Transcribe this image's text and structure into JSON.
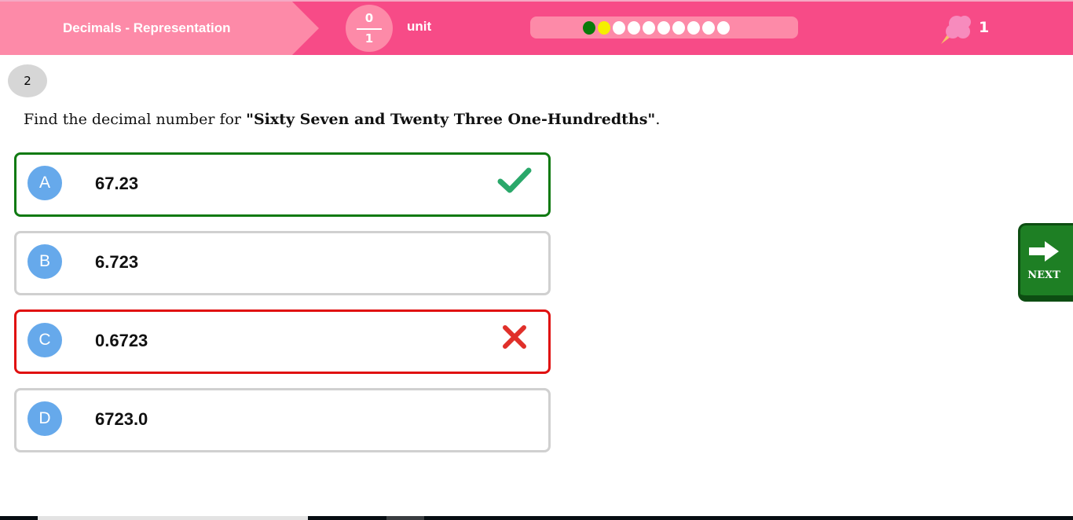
{
  "header": {
    "lesson_title": "Decimals - Representation",
    "fraction": {
      "numerator": "0",
      "denominator": "1"
    },
    "unit_label": "unit",
    "progress_dots": [
      "#0a7a0a",
      "#f5ef00",
      "#ffffff",
      "#ffffff",
      "#ffffff",
      "#ffffff",
      "#ffffff",
      "#ffffff",
      "#ffffff",
      "#ffffff"
    ],
    "reward_icon": "cotton-candy-icon",
    "reward_count": "1"
  },
  "question": {
    "number": "2",
    "prefix": "Find the decimal number for ",
    "quoted": "\"Sixty Seven and Twenty Three One-Hundredths\"",
    "suffix": "."
  },
  "options": [
    {
      "letter": "A",
      "value": "67.23",
      "state": "correct"
    },
    {
      "letter": "B",
      "value": "6.723",
      "state": "none"
    },
    {
      "letter": "C",
      "value": "0.6723",
      "state": "wrong"
    },
    {
      "letter": "D",
      "value": "6723.0",
      "state": "none"
    }
  ],
  "next_button": {
    "label": "NEXT",
    "icon": "arrow-right-icon"
  }
}
